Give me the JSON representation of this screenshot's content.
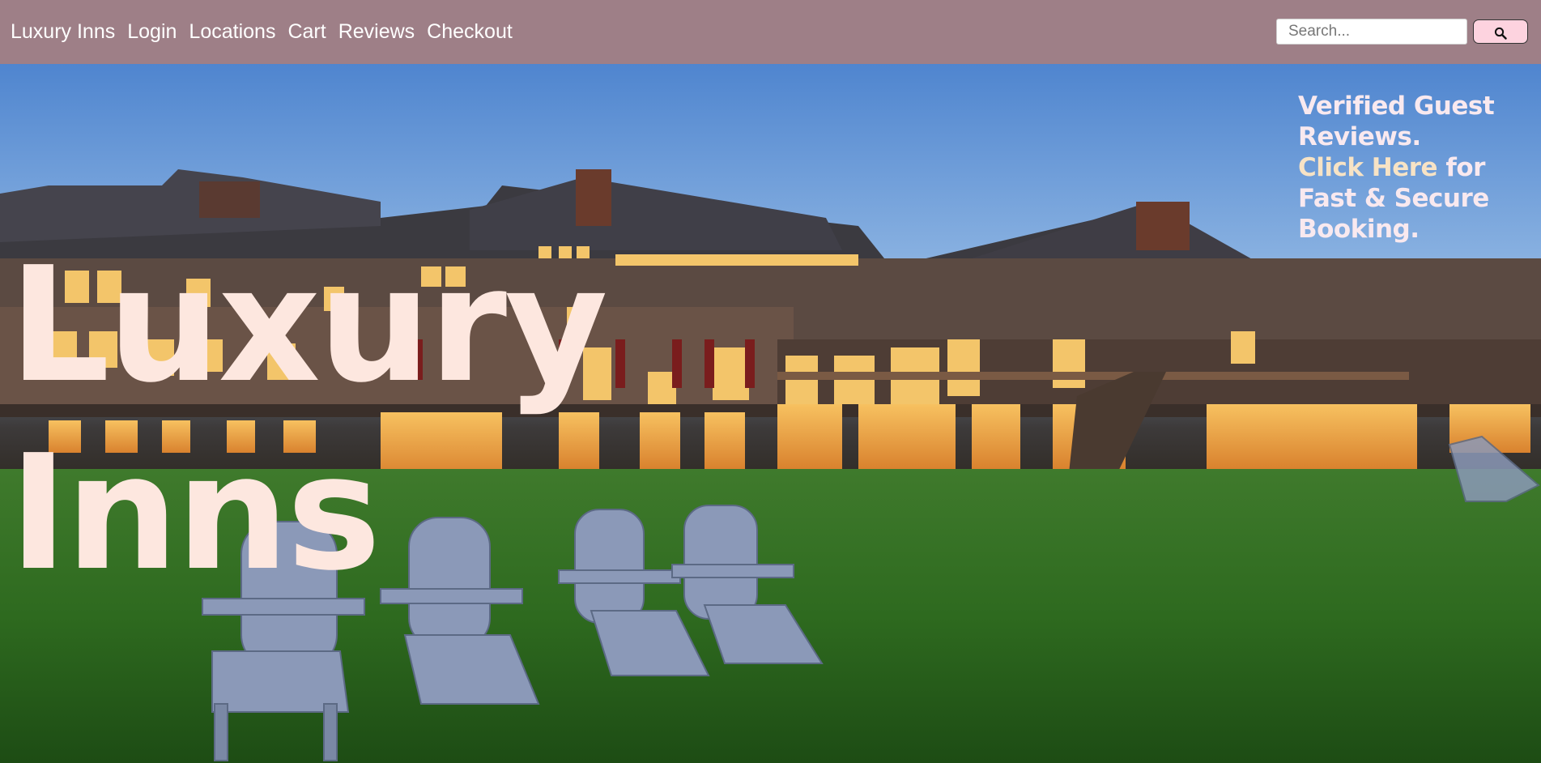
{
  "nav": {
    "links": [
      "Luxury Inns",
      "Login",
      "Locations",
      "Cart",
      "Reviews",
      "Checkout"
    ]
  },
  "search": {
    "placeholder": "Search...",
    "button_icon": "search-icon"
  },
  "hero": {
    "title_line1": "Luxury",
    "title_line2": "Inns",
    "promo_line1": "Verified Guest",
    "promo_line2": "Reviews.",
    "promo_link": "Click Here",
    "promo_rest": " for Fast & Secure Booking.",
    "image": "hotel-exterior-at-dusk-with-adirondack-chairs"
  },
  "colors": {
    "navbar": "#9e7f87",
    "title": "#fde7df",
    "promo": "#f9e9ef",
    "promo_link": "#f7e3c5",
    "search_button": "#fdd3df"
  }
}
